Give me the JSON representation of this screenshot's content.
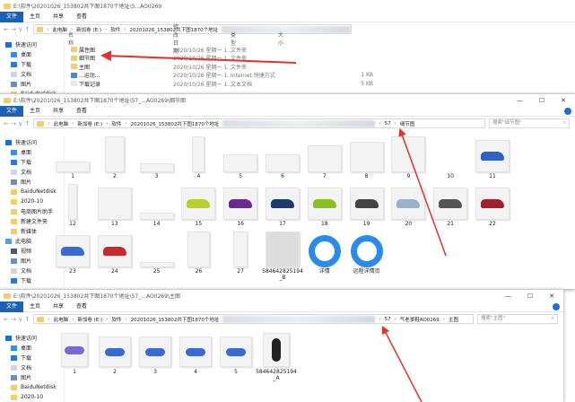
{
  "top_window": {
    "title": "E:\\软件\\20201026_153802共下图1870个地址\\5...AO0269",
    "tabs": [
      "文件",
      "主页",
      "共享",
      "查看"
    ],
    "breadcrumbs": [
      "此电脑",
      "新加卷 (E:)",
      "软件",
      "20201026_153802共下图1870个地址"
    ],
    "columns": [
      "名称",
      "修改日期",
      "类型",
      "大小"
    ],
    "files": [
      {
        "name": "属性图",
        "date": "2020/10/26 星期一 1...",
        "type": "文件夹",
        "size": ""
      },
      {
        "name": "细节图",
        "date": "2020/10/26 星期一 1...",
        "type": "文件夹",
        "size": ""
      },
      {
        "name": "主图",
        "date": "2020/10/26 星期一 1...",
        "type": "文件夹",
        "size": ""
      },
      {
        "name": "...运动...",
        "date": "2020/10/26 星期一 1...",
        "type": "Internet 快捷方式",
        "size": "1 KB"
      },
      {
        "name": "下载记录",
        "date": "2020/10/26 星期一 1...",
        "type": "文本文档",
        "size": "5 KB"
      }
    ],
    "sidebar": [
      "快速访问",
      "桌面",
      "下载",
      "文档",
      "图片",
      "BaiduNetdisk"
    ]
  },
  "middle_window": {
    "title": "E:\\软件\\20201026_153802共下图1870个地址\\57_...AO0269\\细节图",
    "tabs": [
      "文件",
      "主页",
      "共享",
      "查看"
    ],
    "breadcrumbs": [
      "此电脑",
      "新加卷 (E:)",
      "软件",
      "20201026_153802共下图1870个地址",
      "57",
      "细节图"
    ],
    "search_placeholder": "搜索\"细节图\"",
    "sidebar": [
      "快速访问",
      "桌面",
      "下载",
      "文档",
      "图片",
      "BaiduNetdisk",
      "2020-10",
      "电商图片助手",
      "新建文件夹",
      "新媒体",
      "此电脑",
      "视频",
      "图片",
      "文档",
      "下载"
    ],
    "items": [
      "1",
      "2",
      "3",
      "4",
      "5",
      "6",
      "7",
      "8",
      "9",
      "10",
      "11",
      "12",
      "13",
      "14",
      "15",
      "16",
      "17",
      "18",
      "19",
      "20",
      "21",
      "22",
      "23",
      "24",
      "25",
      "26",
      "27",
      "584642825194_B",
      "详情",
      "远程详情页"
    ]
  },
  "bottom_window": {
    "title": "E:\\软件\\20201026_153802共下图1870个地址\\57_...AO0269\\主图",
    "tabs": [
      "文件",
      "主页",
      "共享",
      "查看"
    ],
    "breadcrumbs": [
      "此电脑",
      "新加卷 (E:)",
      "软件",
      "20201026_153802共下图1870个地址",
      "57",
      "气老爹鞋AO0269",
      "主图"
    ],
    "search_placeholder": "搜索\"主图\"",
    "sidebar": [
      "快速访问",
      "桌面",
      "下载",
      "文档",
      "图片",
      "BaiduNetdisk",
      "2020-10"
    ],
    "items": [
      "1",
      "2",
      "3",
      "4",
      "5",
      "584642825194_A"
    ]
  },
  "colors": {
    "accent": "#1a62b8",
    "arrow": "#e8302a",
    "folder": "#f4cd6a"
  }
}
